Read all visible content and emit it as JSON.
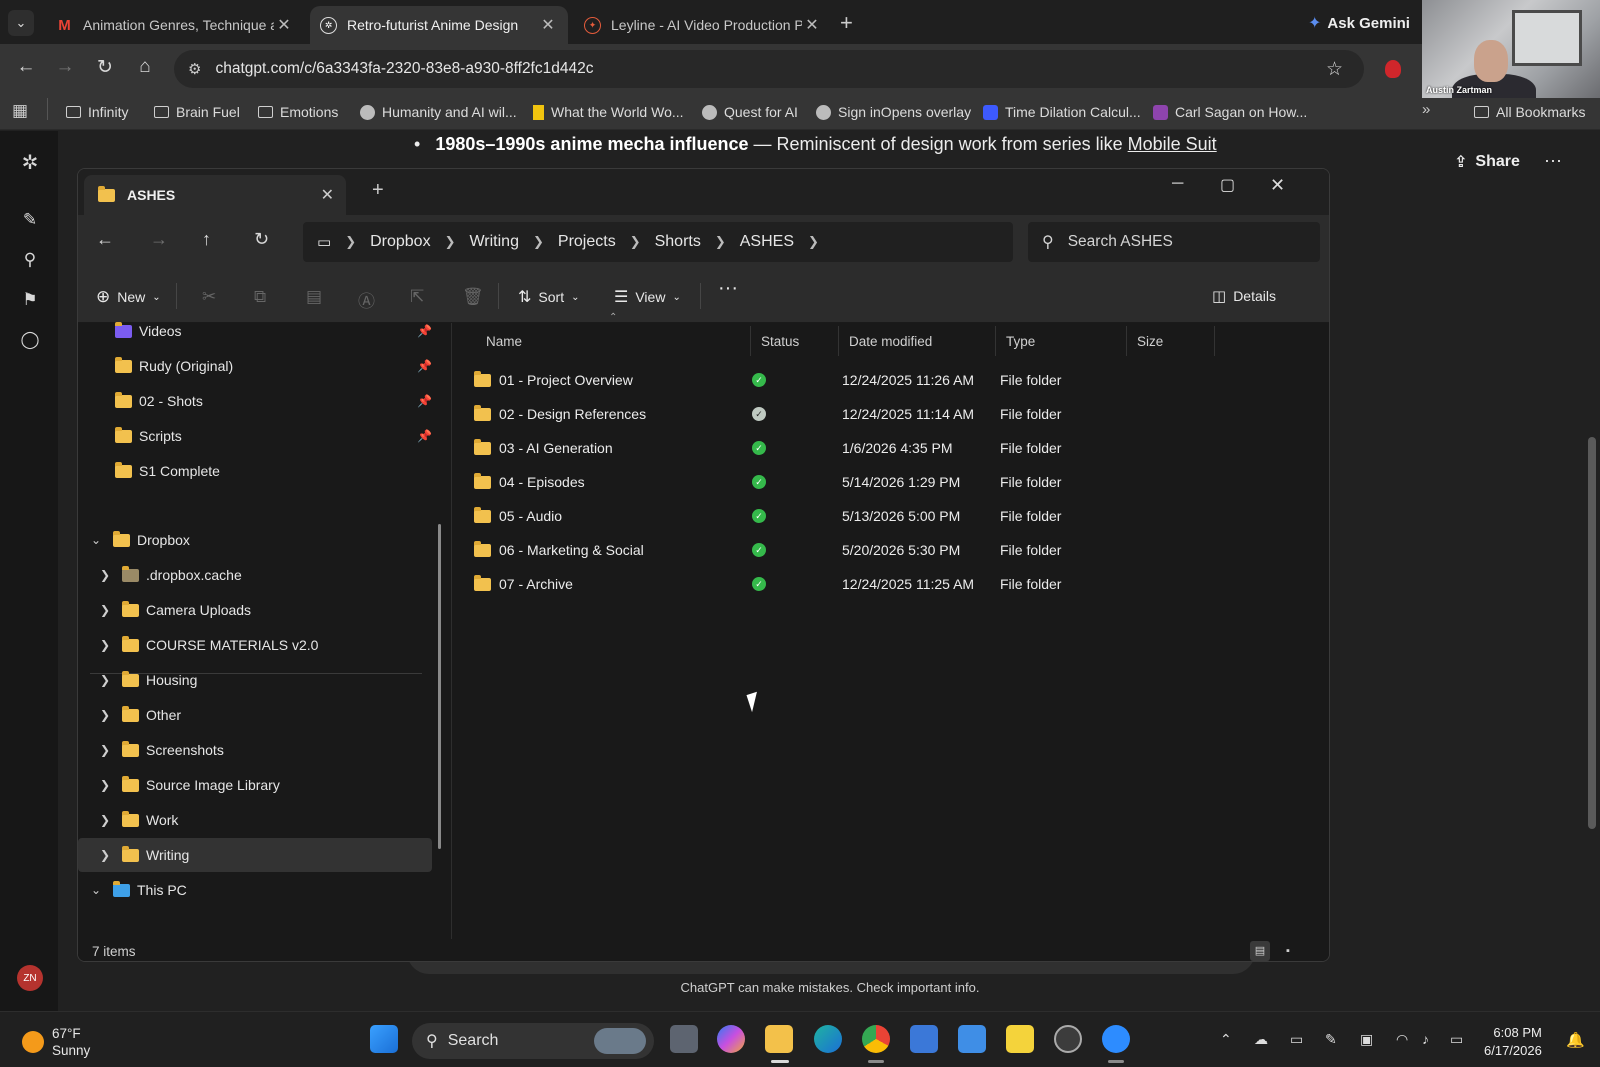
{
  "browser": {
    "tabs": [
      {
        "label": "Animation Genres, Technique a",
        "icon": "gmail-icon",
        "active": false
      },
      {
        "label": "Retro-futurist Anime Design",
        "icon": "chatgpt-icon",
        "active": true
      },
      {
        "label": "Leyline - AI Video Production P",
        "icon": "leyline-icon",
        "active": false
      }
    ],
    "gemini_label": "Ask Gemini",
    "url": "chatgpt.com/c/6a3343fa-2320-83e8-a930-8ff2fc1d442c",
    "bookmarks": [
      {
        "label": "Infinity",
        "icon": "folder-icon"
      },
      {
        "label": "Brain Fuel",
        "icon": "folder-icon"
      },
      {
        "label": "Emotions",
        "icon": "folder-icon"
      },
      {
        "label": "Humanity and AI wil...",
        "icon": "globe-icon"
      },
      {
        "label": "What the World Wo...",
        "icon": "bookmark-yellow-icon"
      },
      {
        "label": "Quest for AI",
        "icon": "globe-icon"
      },
      {
        "label": "Sign inOpens overlay",
        "icon": "globe-icon"
      },
      {
        "label": "Time Dilation Calcul...",
        "icon": "calculator-icon"
      },
      {
        "label": "Carl Sagan on How...",
        "icon": "podcast-icon"
      }
    ],
    "all_bookmarks": "All Bookmarks",
    "webcam_name": "Austin Zartman"
  },
  "chatgpt": {
    "bullet_bold": "1980s–1990s anime mecha influence",
    "bullet_rest": " — Reminiscent of design work from series like ",
    "bullet_link": "Mobile Suit",
    "share": "Share",
    "disclaimer": "ChatGPT can make mistakes. Check important info.",
    "avatar": "ZN"
  },
  "explorer": {
    "tab_title": "ASHES",
    "breadcrumbs": [
      "Dropbox",
      "Writing",
      "Projects",
      "Shorts",
      "ASHES"
    ],
    "search_placeholder": "Search ASHES",
    "commands": {
      "new": "New",
      "sort": "Sort",
      "view": "View",
      "details": "Details"
    },
    "quick_access": [
      {
        "label": "Videos",
        "pinned": true
      },
      {
        "label": "Rudy (Original)",
        "pinned": true
      },
      {
        "label": "02 - Shots",
        "pinned": true
      },
      {
        "label": "Scripts",
        "pinned": true
      },
      {
        "label": "S1 Complete",
        "pinned": false
      }
    ],
    "tree": [
      {
        "label": "Dropbox",
        "level": 0,
        "expanded": true
      },
      {
        "label": ".dropbox.cache",
        "level": 1
      },
      {
        "label": "Camera Uploads",
        "level": 1
      },
      {
        "label": "COURSE MATERIALS v2.0",
        "level": 1
      },
      {
        "label": "Housing",
        "level": 1
      },
      {
        "label": "Other",
        "level": 1
      },
      {
        "label": "Screenshots",
        "level": 1
      },
      {
        "label": "Source Image Library",
        "level": 1
      },
      {
        "label": "Work",
        "level": 1
      },
      {
        "label": "Writing",
        "level": 1,
        "selected": true
      },
      {
        "label": "This PC",
        "level": 0,
        "expanded": true
      }
    ],
    "columns": [
      "Name",
      "Status",
      "Date modified",
      "Type",
      "Size"
    ],
    "rows": [
      {
        "name": "01 - Project Overview",
        "status": "synced",
        "date": "12/24/2025 11:26 AM",
        "type": "File folder"
      },
      {
        "name": "02 - Design References",
        "status": "available",
        "date": "12/24/2025 11:14 AM",
        "type": "File folder"
      },
      {
        "name": "03 - AI Generation",
        "status": "synced",
        "date": "1/6/2026 4:35 PM",
        "type": "File folder"
      },
      {
        "name": "04 - Episodes",
        "status": "synced",
        "date": "5/14/2026 1:29 PM",
        "type": "File folder"
      },
      {
        "name": "05 - Audio",
        "status": "synced",
        "date": "5/13/2026 5:00 PM",
        "type": "File folder"
      },
      {
        "name": "06 - Marketing & Social",
        "status": "synced",
        "date": "5/20/2026 5:30 PM",
        "type": "File folder"
      },
      {
        "name": "07 - Archive",
        "status": "synced",
        "date": "12/24/2025 11:25 AM",
        "type": "File folder"
      }
    ],
    "item_count": "7 items"
  },
  "taskbar": {
    "temp": "67°F",
    "condition": "Sunny",
    "search": "Search",
    "time": "6:08 PM",
    "date": "6/17/2026"
  }
}
